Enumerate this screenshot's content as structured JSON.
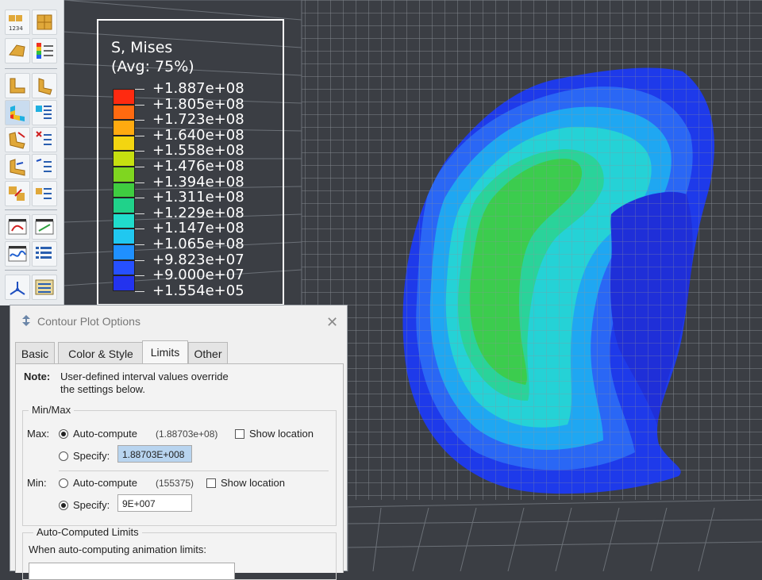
{
  "legend": {
    "title_line1": "S, Mises",
    "title_line2": "(Avg: 75%)",
    "labels": [
      "+1.887e+08",
      "+1.805e+08",
      "+1.723e+08",
      "+1.640e+08",
      "+1.558e+08",
      "+1.476e+08",
      "+1.394e+08",
      "+1.311e+08",
      "+1.229e+08",
      "+1.147e+08",
      "+1.065e+08",
      "+9.823e+07",
      "+9.000e+07",
      "+1.554e+05"
    ],
    "colors": [
      "#ff2a10",
      "#ff6a10",
      "#ffaa10",
      "#f3d510",
      "#c6e010",
      "#7fd620",
      "#3fcc40",
      "#20d28a",
      "#20dccc",
      "#20c8f0",
      "#1f90ff",
      "#2650ff",
      "#2333ee",
      "#b4b4b4"
    ]
  },
  "toolbar": {
    "icons": [
      "edit-hex-icon",
      "edit-hex-3d-icon",
      "spectrum-icon",
      "undeformed-icon",
      "deformed-icon",
      "contour-icon",
      "contour-options-icon",
      "symbol-icon",
      "symbol-options-icon",
      "material-orient-icon",
      "material-orient-options-icon",
      "animate-icon",
      "animate-options-icon",
      "time-history-icon",
      "time-history-options-icon",
      "view-cut-icon",
      "view-cut-manager-icon"
    ]
  },
  "dialog": {
    "title": "Contour Plot Options",
    "tabs": [
      "Basic",
      "Color & Style",
      "Limits",
      "Other"
    ],
    "active_tab": "Limits",
    "note_label": "Note:",
    "note_line1": "User-defined interval values override",
    "note_line2": "the settings below.",
    "minmax_group": "Min/Max",
    "max_label": "Max:",
    "max_auto_label": "Auto-compute",
    "max_auto_value": "(1.88703e+08)",
    "max_show_location": "Show location",
    "max_specify_label": "Specify:",
    "max_specify_value": "1.88703E+008",
    "min_label": "Min:",
    "min_auto_label": "Auto-compute",
    "min_auto_value": "(155375)",
    "min_show_location": "Show location",
    "min_specify_label": "Specify:",
    "min_specify_value": "9E+007",
    "auto_limits_group": "Auto-Computed Limits",
    "auto_limits_text": "When auto-computing animation limits:",
    "max_auto_selected": true,
    "min_specify_selected": true,
    "show_location_max": false,
    "show_location_min": false
  }
}
